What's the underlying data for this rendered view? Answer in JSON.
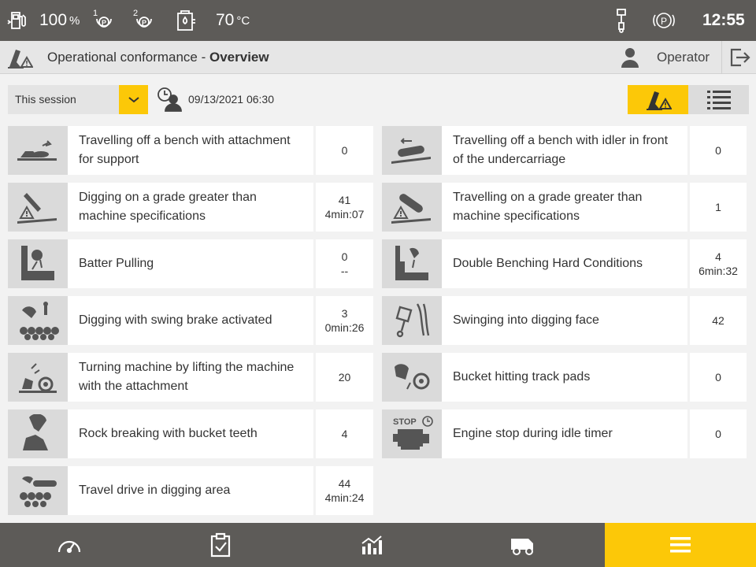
{
  "status_bar": {
    "fuel_level": "100",
    "fuel_unit": "%",
    "park1_label": "1",
    "park2_label": "2",
    "temperature": "70",
    "temperature_unit": "°C",
    "time": "12:55"
  },
  "header": {
    "title_prefix": "Operational conformance - ",
    "title_bold": "Overview",
    "user_label": "Operator"
  },
  "filter": {
    "session_selected": "This session",
    "datetime": "09/13/2021 06:30"
  },
  "items_left": [
    {
      "label_lines": [
        "Travelling off a bench with attachment",
        "for support"
      ],
      "value1": "0",
      "value2": ""
    },
    {
      "label_lines": [
        "Digging on a grade greater than",
        "machine specifications"
      ],
      "value1": "41",
      "value2": "4min:07"
    },
    {
      "label_lines": [
        "Batter Pulling"
      ],
      "value1": "0",
      "value2": "--"
    },
    {
      "label_lines": [
        "Digging with swing brake activated"
      ],
      "value1": "3",
      "value2": "0min:26"
    },
    {
      "label_lines": [
        "Turning machine by lifting the machine",
        "with the attachment"
      ],
      "value1": "20",
      "value2": ""
    },
    {
      "label_lines": [
        "Rock breaking with bucket teeth"
      ],
      "value1": "4",
      "value2": ""
    },
    {
      "label_lines": [
        "Travel drive in digging area"
      ],
      "value1": "44",
      "value2": "4min:24"
    }
  ],
  "items_right": [
    {
      "label_lines": [
        "Travelling off a bench with idler in front",
        "of the undercarriage"
      ],
      "value1": "0",
      "value2": ""
    },
    {
      "label_lines": [
        "Travelling on a grade greater than",
        "machine specifications"
      ],
      "value1": "1",
      "value2": ""
    },
    {
      "label_lines": [
        "Double Benching Hard Conditions"
      ],
      "value1": "4",
      "value2": "6min:32"
    },
    {
      "label_lines": [
        "Swinging into digging face"
      ],
      "value1": "42",
      "value2": ""
    },
    {
      "label_lines": [
        "Bucket hitting track pads"
      ],
      "value1": "0",
      "value2": ""
    },
    {
      "label_lines": [
        "Engine stop during idle timer"
      ],
      "value1": "0",
      "value2": "",
      "icon_text": "STOP"
    }
  ],
  "colors": {
    "accent": "#fcc808",
    "dark_bar": "#5d5b58",
    "icon_bg": "#dadada"
  },
  "icons": {
    "fuel": "fuel-pump-icon",
    "park1": "parking-brake-1-icon",
    "park2": "parking-brake-2-icon",
    "coolant": "coolant-temperature-icon",
    "hydraulic": "hydraulic-cylinder-icon",
    "park_brake": "parking-brake-icon",
    "logout": "logout-icon",
    "nav": [
      "speedometer-icon",
      "checklist-icon",
      "chart-icon",
      "haul-truck-icon",
      "menu-icon"
    ]
  }
}
